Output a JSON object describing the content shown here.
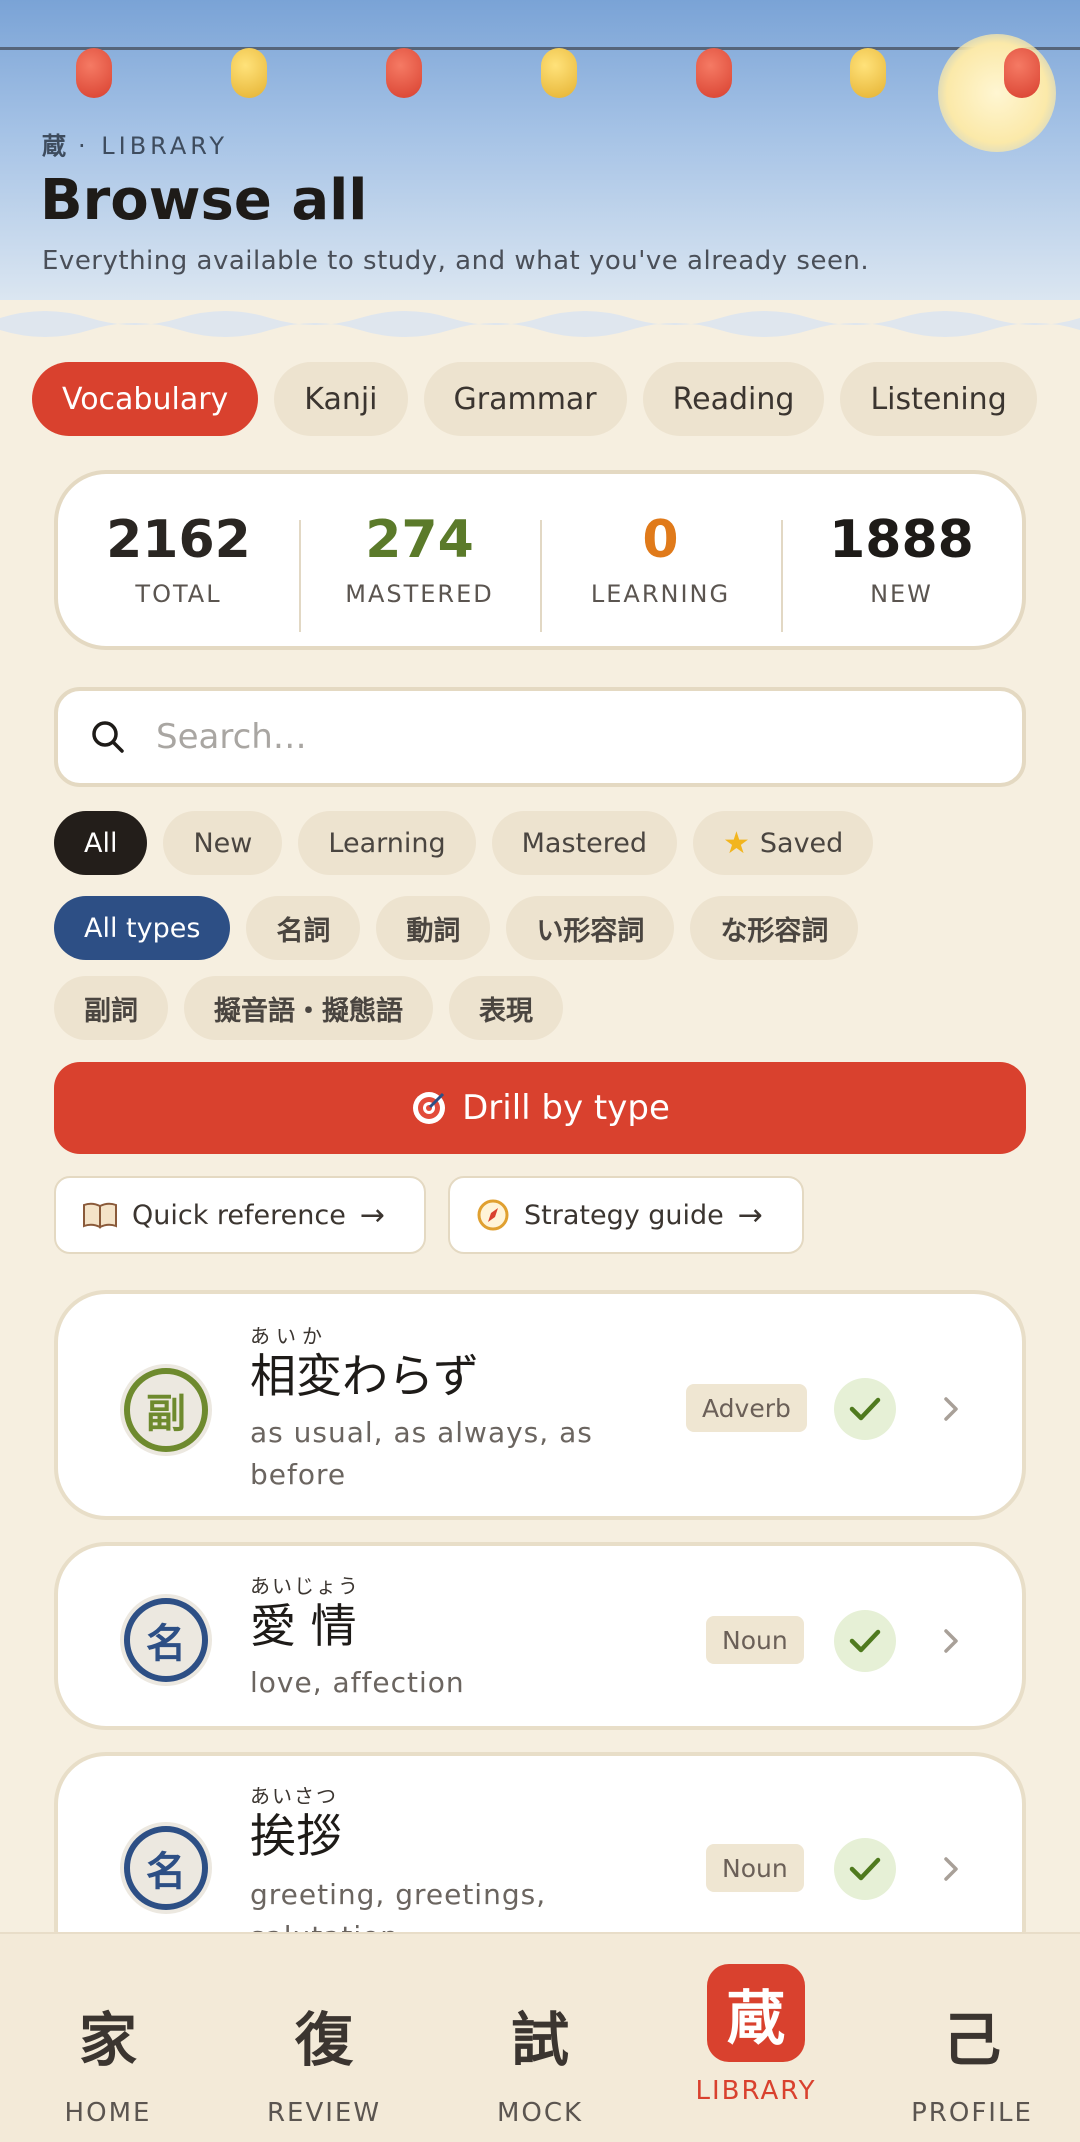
{
  "header": {
    "eyebrow_kanji": "蔵",
    "eyebrow_label": "· LIBRARY",
    "title": "Browse all",
    "subtitle": "Everything available to study, and what you've already seen."
  },
  "category_tabs": [
    {
      "label": "Vocabulary",
      "active": true
    },
    {
      "label": "Kanji"
    },
    {
      "label": "Grammar"
    },
    {
      "label": "Reading"
    },
    {
      "label": "Listening"
    }
  ],
  "stats": [
    {
      "value": "2162",
      "label": "TOTAL",
      "color": "#2a2622"
    },
    {
      "value": "274",
      "label": "MASTERED",
      "color": "#5b7a2a"
    },
    {
      "value": "0",
      "label": "LEARNING",
      "color": "#e07a1a"
    },
    {
      "value": "1888",
      "label": "NEW",
      "color": "#1e1b18"
    }
  ],
  "search": {
    "placeholder": "Search…",
    "value": ""
  },
  "status_filters": [
    {
      "label": "All",
      "active": true
    },
    {
      "label": "New"
    },
    {
      "label": "Learning"
    },
    {
      "label": "Mastered"
    },
    {
      "label": "Saved",
      "icon": "star-icon"
    }
  ],
  "type_filters": [
    {
      "label": "All types",
      "active": true
    },
    {
      "label": "名詞"
    },
    {
      "label": "動詞"
    },
    {
      "label": "い形容詞"
    },
    {
      "label": "な形容詞"
    },
    {
      "label": "副詞"
    },
    {
      "label": "擬音語・擬態語"
    },
    {
      "label": "表現"
    }
  ],
  "drill_button": {
    "label": "Drill by type",
    "icon": "target-icon"
  },
  "quick_reference": {
    "label": "Quick reference",
    "icon": "book-icon"
  },
  "strategy_guide": {
    "label": "Strategy guide",
    "icon": "compass-icon"
  },
  "words": [
    {
      "badge": "副",
      "badge_color": "#6e8a2e",
      "reading": "あいか",
      "word": "相変わらず",
      "meaning": "as usual, as always, as before",
      "pos": "Adverb",
      "mastered": true
    },
    {
      "badge": "名",
      "badge_color": "#2d4f85",
      "reading": "あいじょう",
      "word": "愛 情",
      "meaning": "love, affection",
      "pos": "Noun",
      "mastered": true
    },
    {
      "badge": "名",
      "badge_color": "#2d4f85",
      "reading": "あいさつ",
      "word": "挨拶",
      "meaning": "greeting, greetings, salutation",
      "pos": "Noun",
      "mastered": true
    }
  ],
  "nav": [
    {
      "glyph": "家",
      "label": "HOME"
    },
    {
      "glyph": "復",
      "label": "REVIEW"
    },
    {
      "glyph": "試",
      "label": "MOCK"
    },
    {
      "glyph": "蔵",
      "label": "LIBRARY",
      "active": true
    },
    {
      "glyph": "己",
      "label": "PROFILE"
    }
  ],
  "colors": {
    "accent": "#d9412e",
    "navy": "#2d4f85",
    "cream": "#f6efe0"
  }
}
